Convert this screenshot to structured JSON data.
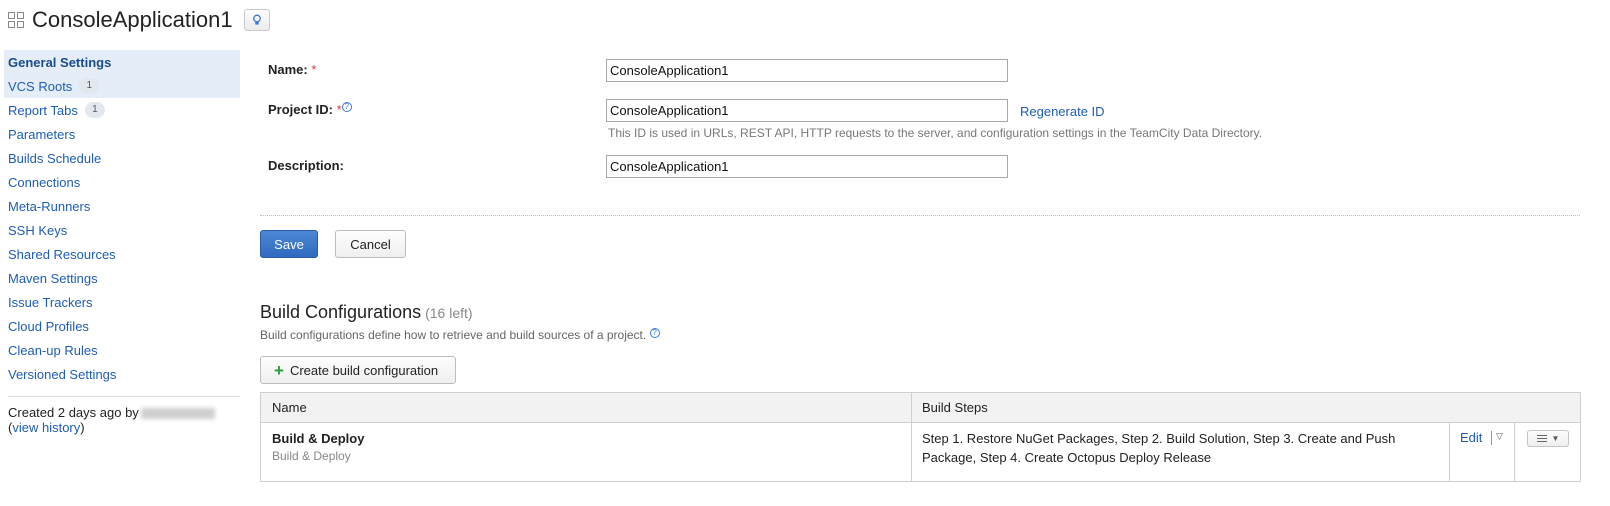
{
  "header": {
    "title": "ConsoleApplication1",
    "icons": {
      "project": "grid-icon",
      "hint": "lightbulb-icon"
    }
  },
  "sidebar": {
    "items": [
      {
        "label": "General Settings",
        "badge": ""
      },
      {
        "label": "VCS Roots",
        "badge": "1"
      },
      {
        "label": "Report Tabs",
        "badge": "1"
      },
      {
        "label": "Parameters",
        "badge": ""
      },
      {
        "label": "Builds Schedule",
        "badge": ""
      },
      {
        "label": "Connections",
        "badge": ""
      },
      {
        "label": "Meta-Runners",
        "badge": ""
      },
      {
        "label": "SSH Keys",
        "badge": ""
      },
      {
        "label": "Shared Resources",
        "badge": ""
      },
      {
        "label": "Maven Settings",
        "badge": ""
      },
      {
        "label": "Issue Trackers",
        "badge": ""
      },
      {
        "label": "Cloud Profiles",
        "badge": ""
      },
      {
        "label": "Clean-up Rules",
        "badge": ""
      },
      {
        "label": "Versioned Settings",
        "badge": ""
      }
    ],
    "created_prefix": "Created 2 days ago by",
    "view_history_label": "view history"
  },
  "form": {
    "name_label": "Name:",
    "name_value": "ConsoleApplication1",
    "project_id_label": "Project ID:",
    "project_id_value": "ConsoleApplication1",
    "regenerate_label": "Regenerate ID",
    "project_id_hint": "This ID is used in URLs, REST API, HTTP requests to the server, and configuration settings in the TeamCity Data Directory.",
    "description_label": "Description:",
    "description_value": "ConsoleApplication1",
    "required_mark": "*",
    "save_label": "Save",
    "cancel_label": "Cancel"
  },
  "build_configurations": {
    "title": "Build Configurations",
    "left_count": "(16 left)",
    "description": "Build configurations define how to retrieve and build sources of a project.",
    "create_label": "Create build configuration",
    "columns": [
      "Name",
      "Build Steps"
    ],
    "rows": [
      {
        "name": "Build & Deploy",
        "subtitle": "Build & Deploy",
        "steps": "Step 1. Restore NuGet Packages, Step 2. Build Solution, Step 3. Create and Push Package, Step 4. Create Octopus Deploy Release",
        "edit_label": "Edit"
      }
    ]
  },
  "colors": {
    "link": "#1f5db3",
    "active_nav_bg": "#e5eef8",
    "primary_button": "#2f6ac0",
    "required": "#d23a3a",
    "plus": "#2e9a3a"
  }
}
